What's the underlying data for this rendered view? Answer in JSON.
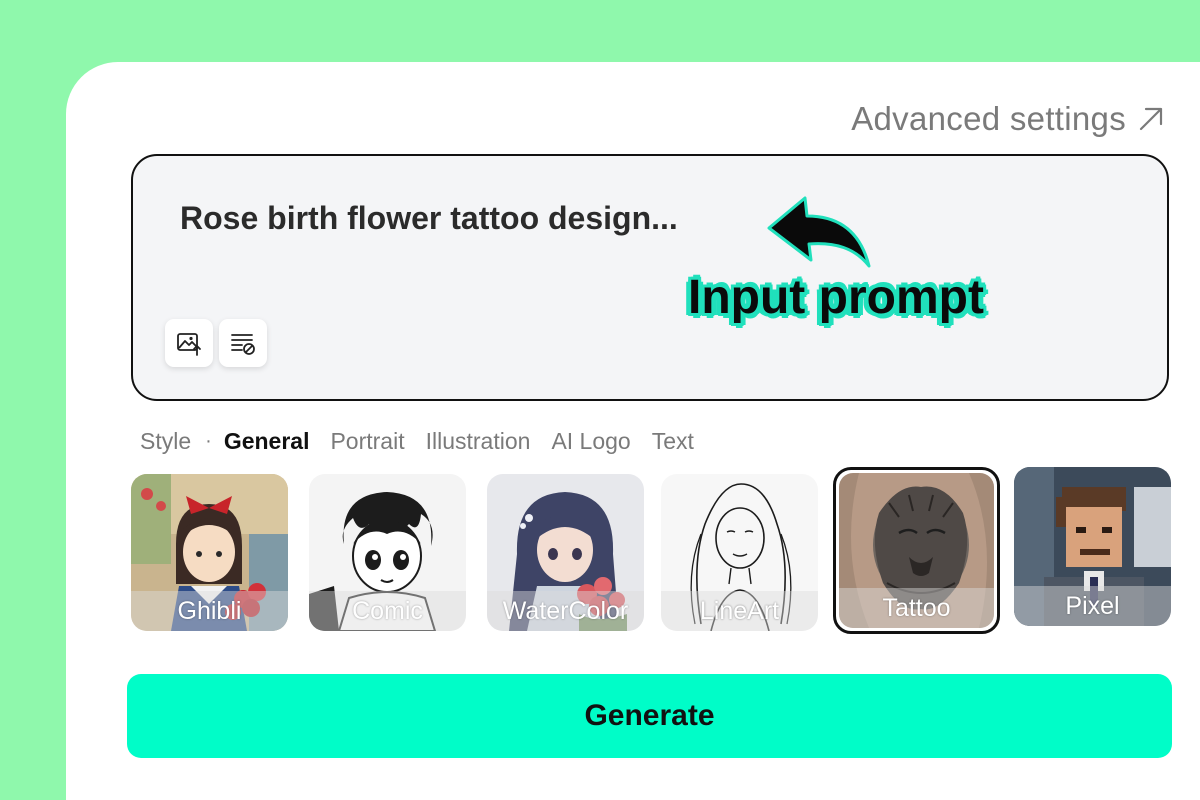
{
  "advanced_settings": {
    "label": "Advanced settings"
  },
  "prompt": {
    "text": "Rose birth flower tattoo design...",
    "callout": "Input prompt"
  },
  "tools": [
    {
      "icon": "image-upload-icon"
    },
    {
      "icon": "clear-text-icon"
    }
  ],
  "style_bar": {
    "label": "Style",
    "separator": "·",
    "tabs": [
      "General",
      "Portrait",
      "Illustration",
      "AI Logo",
      "Text"
    ],
    "active": "General"
  },
  "styles": [
    {
      "name": "Ghibli"
    },
    {
      "name": "Comic"
    },
    {
      "name": "WaterColor"
    },
    {
      "name": "LineArt"
    },
    {
      "name": "Tattoo",
      "selected": true
    },
    {
      "name": "Pixel"
    }
  ],
  "generate": {
    "label": "Generate"
  },
  "colors": {
    "background": "#8ff8ac",
    "accent": "#00fdc8",
    "callout_outline": "#20e0bc"
  }
}
